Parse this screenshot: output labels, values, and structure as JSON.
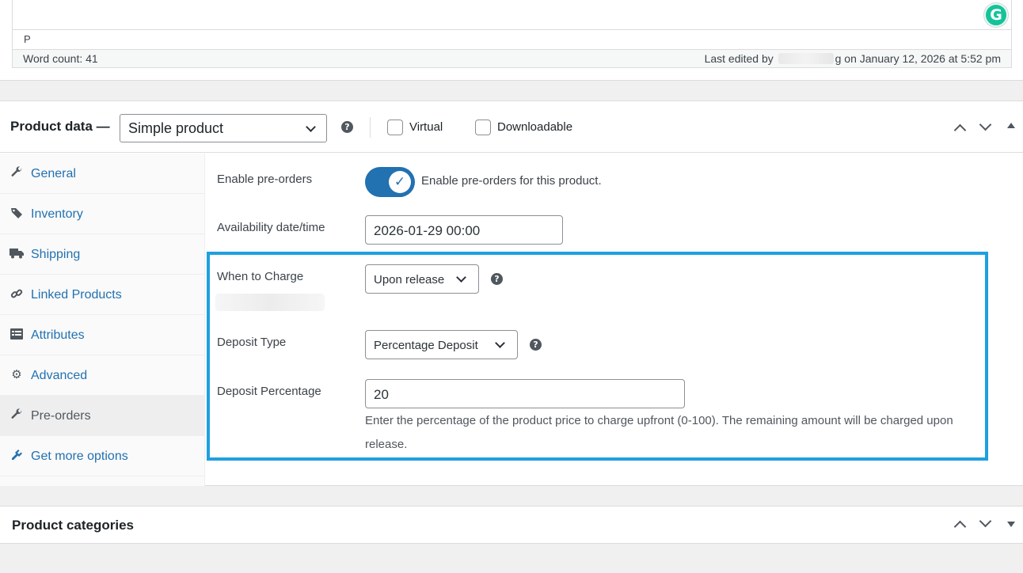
{
  "editor": {
    "path": "P",
    "word_count": "Word count: 41",
    "last_edited_prefix": "Last edited by",
    "last_edited_suffix": "g on January 12, 2026 at 5:52 pm",
    "grammarly_letter": "G"
  },
  "product_data": {
    "title": "Product data —",
    "product_type": "Simple product",
    "virtual_label": "Virtual",
    "downloadable_label": "Downloadable",
    "virtual_checked": false,
    "downloadable_checked": false,
    "tabs": [
      {
        "label": "General",
        "icon": "wrench-icon"
      },
      {
        "label": "Inventory",
        "icon": "tag-icon"
      },
      {
        "label": "Shipping",
        "icon": "truck-icon"
      },
      {
        "label": "Linked Products",
        "icon": "link-icon"
      },
      {
        "label": "Attributes",
        "icon": "list-icon"
      },
      {
        "label": "Advanced",
        "icon": "gear-icon"
      },
      {
        "label": "Pre-orders",
        "icon": "wrench-icon"
      },
      {
        "label": "Get more options",
        "icon": "plugin-icon"
      }
    ],
    "active_tab": "Pre-orders",
    "fields": {
      "enable_preorders_label": "Enable pre-orders",
      "enable_preorders_text": "Enable pre-orders for this product.",
      "enable_preorders_on": true,
      "availability_label": "Availability date/time",
      "availability_value": "2026-01-29 00:00",
      "when_to_charge_label": "When to Charge",
      "when_to_charge_value": "Upon release",
      "deposit_type_label": "Deposit Type",
      "deposit_type_value": "Percentage Deposit",
      "deposit_percentage_label": "Deposit Percentage",
      "deposit_percentage_value": "20",
      "deposit_percentage_desc": "Enter the percentage of the product price to charge upfront (0-100). The remaining amount will be charged upon release."
    },
    "highlight_color": "#1ea0e0"
  },
  "categories": {
    "title": "Product categories"
  },
  "colors": {
    "accent": "#2271b1",
    "grammarly": "#15c39a"
  }
}
